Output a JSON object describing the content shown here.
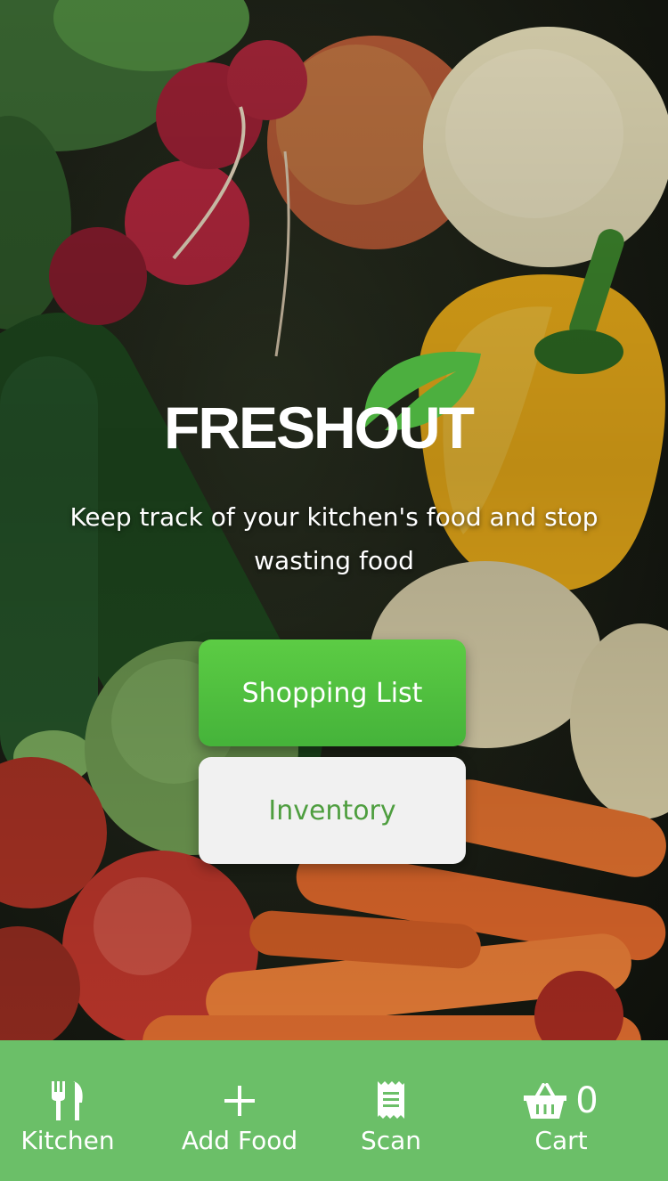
{
  "app": {
    "brand": "FRESHOUT",
    "tagline": "Keep track of your kitchen's food and stop wasting food",
    "accent_color": "#5ccc44",
    "nav_color": "#6bbf68"
  },
  "actions": {
    "shopping_list_label": "Shopping List",
    "inventory_label": "Inventory"
  },
  "nav": {
    "items": [
      {
        "label": "Kitchen",
        "icon": "fork-knife-icon"
      },
      {
        "label": "Add Food",
        "icon": "plus-icon"
      },
      {
        "label": "Scan",
        "icon": "receipt-icon"
      },
      {
        "label": "Cart",
        "icon": "basket-icon"
      }
    ],
    "cart_count": "0"
  }
}
